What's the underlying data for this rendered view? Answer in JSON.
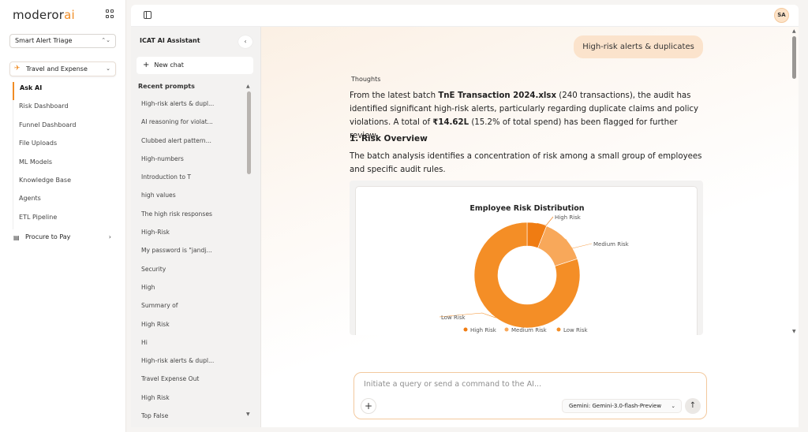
{
  "brand": {
    "logo_left": "moderor",
    "logo_right": "ai"
  },
  "nav": {
    "workflow_select": "Smart Alert Triage",
    "module": "Travel and Expense",
    "items": [
      {
        "label": "Ask AI",
        "active": true
      },
      {
        "label": "Risk Dashboard"
      },
      {
        "label": "Funnel Dashboard"
      },
      {
        "label": "File Uploads"
      },
      {
        "label": "ML Models"
      },
      {
        "label": "Knowledge Base"
      },
      {
        "label": "Agents"
      },
      {
        "label": "ETL Pipeline"
      }
    ],
    "other_module": "Procure to Pay"
  },
  "user": {
    "initials": "SA"
  },
  "history": {
    "title": "ICAT AI Assistant",
    "new_chat": "New chat",
    "recent_label": "Recent prompts",
    "items": [
      "High-risk alerts & dupl...",
      "AI reasoning for violat...",
      "Clubbed alert pattern...",
      "High-numbers",
      "Introduction to T",
      "high values",
      "The high risk responses",
      "High-Risk",
      "My password is \"jandj...",
      "Security",
      "High",
      "Summary of",
      "High Risk",
      "Hi",
      "High-risk alerts & dupl...",
      "Travel Expense Out",
      "High Risk",
      "Top False"
    ]
  },
  "chat": {
    "user_message": "High-risk alerts & duplicates",
    "thoughts_label": "Thoughts",
    "p1": {
      "t1": "From the latest batch ",
      "file": "TnE Transaction 2024.xlsx",
      "t2": " (240 transactions), the audit has identified significant high-risk alerts, particularly regarding duplicate claims and policy violations. A total of ",
      "amount": "₹14.62L",
      "t3": " (15.2% of total spend) has been flagged for further review."
    },
    "section_heading": "1. Risk Overview",
    "p2": "The batch analysis identifies a concentration of risk among a small group of employees and specific audit rules."
  },
  "chart_data": {
    "type": "pie",
    "title": "Employee Risk Distribution",
    "categories": [
      "High Risk",
      "Medium Risk",
      "Low Risk"
    ],
    "values": [
      6,
      14,
      80
    ],
    "colors": [
      "#f07c12",
      "#f8a85a",
      "#f48e26"
    ],
    "legend": "bottom",
    "donut": true
  },
  "composer": {
    "placeholder": "Initiate a query or send a command to the AI...",
    "model": "Gemini: Gemini-3.0-flash-Preview"
  }
}
